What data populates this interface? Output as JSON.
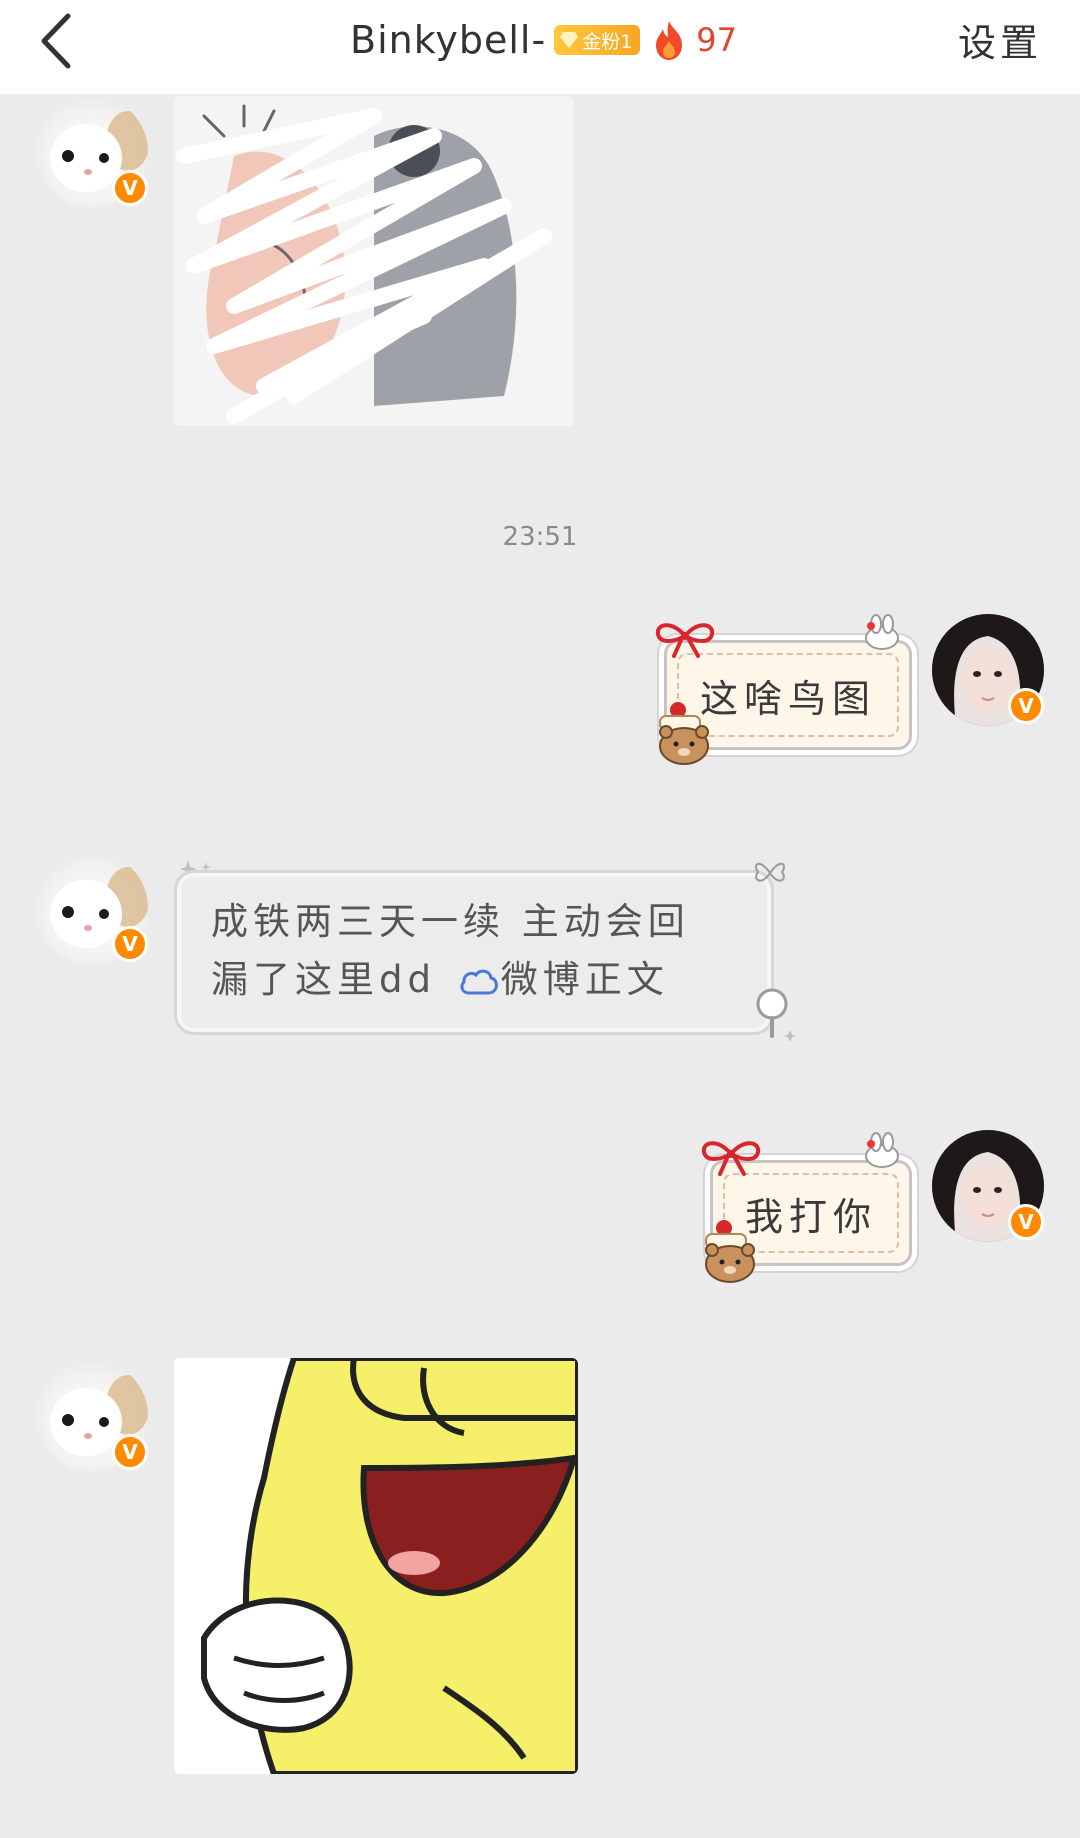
{
  "header": {
    "title": "Binkybell-",
    "fan_badge": "金粉1",
    "heat_count": "97",
    "settings_label": "设置",
    "accent_color": "#e2442f",
    "badge_color": "#f6a623"
  },
  "messages": [
    {
      "side": "incoming",
      "type": "image",
      "sticker": "scribbled-penguin-sticker"
    },
    {
      "type": "timestamp",
      "text": "23:51"
    },
    {
      "side": "outgoing",
      "type": "text",
      "text": "这啥鸟图"
    },
    {
      "side": "incoming",
      "type": "text",
      "line1": "成铁两三天一续 主动会回",
      "line2_prefix": "漏了这里dd",
      "link_text": "微博正文"
    },
    {
      "side": "outgoing",
      "type": "text",
      "text": "我打你"
    },
    {
      "side": "incoming",
      "type": "image",
      "sticker": "yellow-laughing-duck-sticker"
    }
  ],
  "verified_badge": "V",
  "icons": {
    "back": "chevron-left-icon",
    "flame": "flame-icon",
    "cloud": "weibo-cloud-icon"
  }
}
